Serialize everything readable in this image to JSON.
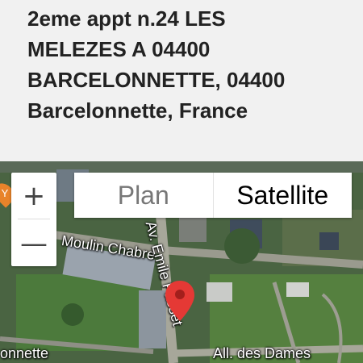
{
  "address": {
    "lines": [
      "2eme appt n.24 LES",
      "MELEZES A 04400",
      "BARCELONNETTE, 04400",
      "Barcelonnette, France"
    ]
  },
  "map": {
    "zoom_in_label": "+",
    "zoom_out_label": "—",
    "map_type": {
      "plan_label": "Plan",
      "satellite_label": "Satellite",
      "selected": "Satellite"
    },
    "labels": {
      "street1": "Moulin Chabre",
      "street2": "Av. Emile Fasset",
      "street3": "All. des Dames",
      "town": "onnette",
      "partial_text": "de"
    },
    "marker_color": "#e53935",
    "poi_color": "#e8832a",
    "poi_icon": "restaurant-icon"
  }
}
